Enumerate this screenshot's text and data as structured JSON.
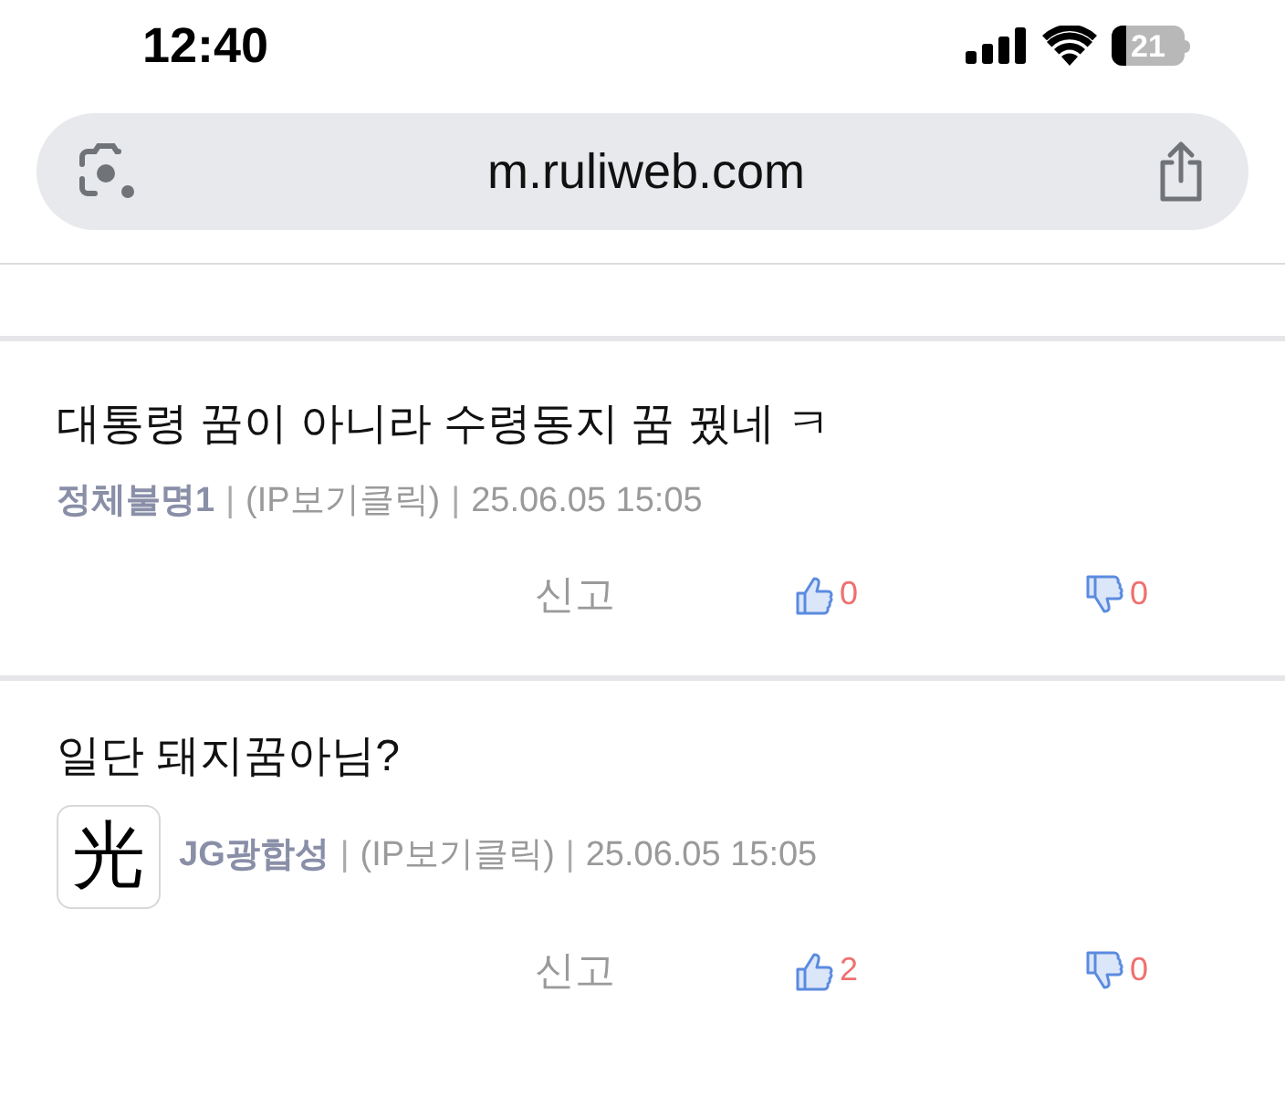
{
  "status_bar": {
    "time": "12:40",
    "battery": "21"
  },
  "address_bar": {
    "url": "m.ruliweb.com"
  },
  "comments": [
    {
      "text": "대통령 꿈이 아니라 수령동지 꿈 꿨네 ㅋ",
      "author": "정체불명1",
      "separator_1": "|",
      "ip": "(IP보기클릭)",
      "separator_2": "|",
      "date": "25.06.05 15:05",
      "report": "신고",
      "likes": "0",
      "dislikes": "0"
    },
    {
      "text": "일단 돼지꿈아님?",
      "avatar": "光",
      "author": "JG광합성",
      "separator_1": "|",
      "ip": "(IP보기클릭)",
      "separator_2": "|",
      "date": "25.06.05 15:05",
      "report": "신고",
      "likes": "2",
      "dislikes": "0"
    }
  ]
}
